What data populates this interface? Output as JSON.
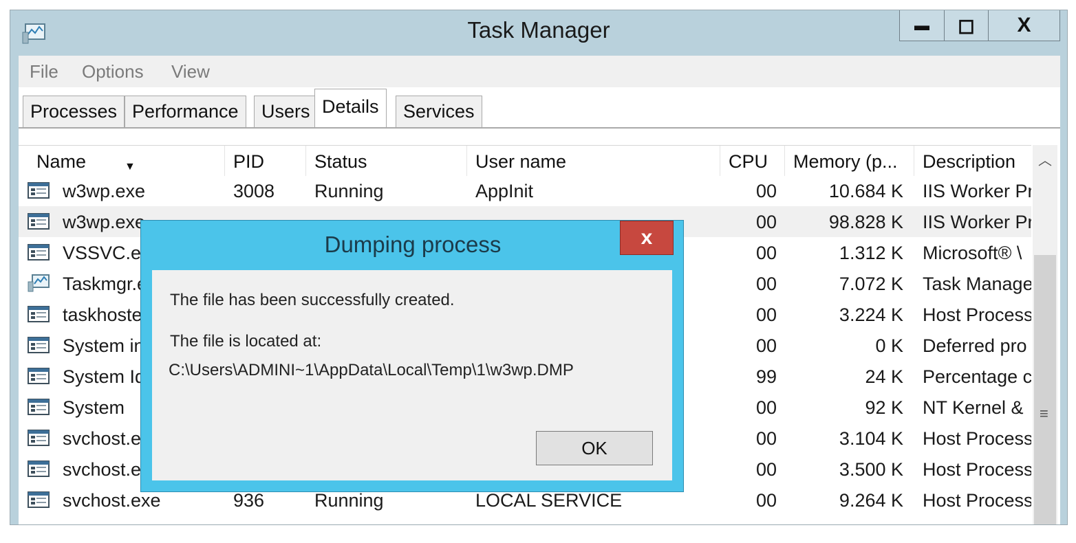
{
  "window": {
    "title": "Task Manager",
    "controls": {
      "minimize": "▬",
      "maximize": "◻",
      "close": "X"
    }
  },
  "menu": [
    "File",
    "Options",
    "View"
  ],
  "tabs": [
    "Processes",
    "Performance",
    "Users",
    "Details",
    "Services"
  ],
  "active_tab": "Details",
  "columns": [
    "Name",
    "PID",
    "Status",
    "User name",
    "CPU",
    "Memory (p...",
    "Description"
  ],
  "rows": [
    {
      "name": "w3wp.exe",
      "pid": "3008",
      "status": "Running",
      "user": "AppInit",
      "cpu": "00",
      "memory": "10.684 K",
      "description": "IIS Worker Pr",
      "icon": "process-icon"
    },
    {
      "name": "w3wp.exe",
      "pid": "",
      "status": "",
      "user": "",
      "cpu": "00",
      "memory": "98.828 K",
      "description": "IIS Worker Pr",
      "icon": "process-icon",
      "selected": true
    },
    {
      "name": "VSSVC.exe",
      "pid": "",
      "status": "",
      "user": "",
      "cpu": "00",
      "memory": "1.312 K",
      "description": "Microsoft® \\",
      "icon": "process-icon"
    },
    {
      "name": "Taskmgr.e",
      "pid": "",
      "status": "",
      "user": "",
      "cpu": "00",
      "memory": "7.072 K",
      "description": "Task Manage",
      "icon": "taskmgr-icon"
    },
    {
      "name": "taskhostex",
      "pid": "",
      "status": "",
      "user": "",
      "cpu": "00",
      "memory": "3.224 K",
      "description": "Host Process",
      "icon": "process-icon"
    },
    {
      "name": "System int",
      "pid": "",
      "status": "",
      "user": "",
      "cpu": "00",
      "memory": "0 K",
      "description": "Deferred pro",
      "icon": "process-icon"
    },
    {
      "name": "System Idl",
      "pid": "",
      "status": "",
      "user": "",
      "cpu": "99",
      "memory": "24 K",
      "description": "Percentage c",
      "icon": "process-icon"
    },
    {
      "name": "System",
      "pid": "",
      "status": "",
      "user": "",
      "cpu": "00",
      "memory": "92 K",
      "description": "NT Kernel &",
      "icon": "process-icon"
    },
    {
      "name": "svchost.ex",
      "pid": "",
      "status": "",
      "user": "",
      "cpu": "00",
      "memory": "3.104 K",
      "description": "Host Process",
      "icon": "process-icon"
    },
    {
      "name": "svchost.ex",
      "pid": "",
      "status": "",
      "user": "",
      "cpu": "00",
      "memory": "3.500 K",
      "description": "Host Process",
      "icon": "process-icon"
    },
    {
      "name": "svchost.exe",
      "pid": "936",
      "status": "Running",
      "user": "LOCAL SERVICE",
      "cpu": "00",
      "memory": "9.264 K",
      "description": "Host Process",
      "icon": "process-icon"
    }
  ],
  "dialog": {
    "title": "Dumping process",
    "close": "x",
    "line1": "The file has been successfully created.",
    "line2": "The file is located at:",
    "path": "C:\\Users\\ADMINI~1\\AppData\\Local\\Temp\\1\\w3wp.DMP",
    "ok": "OK"
  },
  "colors": {
    "titlebar": "#b9d1dc",
    "dialog_frame": "#4bc4ea",
    "dialog_close": "#c7483f",
    "selected_row": "#f0f0f0"
  }
}
